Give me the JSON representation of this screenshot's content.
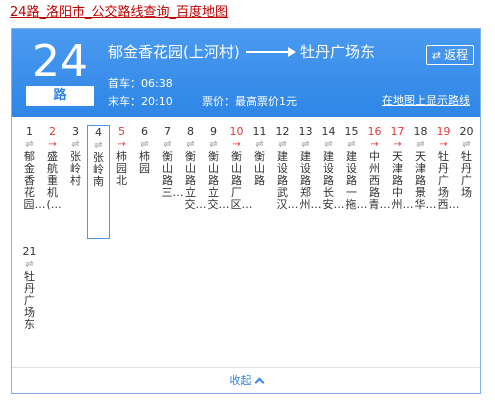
{
  "page_link": "24路_洛阳市_公交路线查询_百度地图",
  "route": {
    "number": "24",
    "unit": "路",
    "from": "郁金香花园(上河村)",
    "to": "牡丹广场东",
    "return_label": "返程",
    "first_bus": "首车：06:38",
    "last_bus": "末车：20:10",
    "fare": "票价：最高票价1元",
    "map_link": "在地图上显示路线"
  },
  "stops": [
    {
      "num": "1",
      "name": "郁金香花园…",
      "highlight": false,
      "selected": false
    },
    {
      "num": "2",
      "name": "盛航重机(…",
      "highlight": true,
      "selected": false
    },
    {
      "num": "3",
      "name": "张岭村",
      "highlight": false,
      "selected": false
    },
    {
      "num": "4",
      "name": "张岭南",
      "highlight": false,
      "selected": true
    },
    {
      "num": "5",
      "name": "柿园北",
      "highlight": true,
      "selected": false
    },
    {
      "num": "6",
      "name": "柿园",
      "highlight": false,
      "selected": false
    },
    {
      "num": "7",
      "name": "衡山路三…",
      "highlight": false,
      "selected": false
    },
    {
      "num": "8",
      "name": "衡山路立交…",
      "highlight": false,
      "selected": false
    },
    {
      "num": "9",
      "name": "衡山路立交…",
      "highlight": false,
      "selected": false
    },
    {
      "num": "10",
      "name": "衡山路厂区…",
      "highlight": true,
      "selected": false
    },
    {
      "num": "11",
      "name": "衡山路",
      "highlight": false,
      "selected": false
    },
    {
      "num": "12",
      "name": "建设路武汉…",
      "highlight": false,
      "selected": false
    },
    {
      "num": "13",
      "name": "建设路郑州…",
      "highlight": false,
      "selected": false
    },
    {
      "num": "14",
      "name": "建设路长安…",
      "highlight": false,
      "selected": false
    },
    {
      "num": "15",
      "name": "建设路一拖…",
      "highlight": false,
      "selected": false
    },
    {
      "num": "16",
      "name": "中州西路青…",
      "highlight": true,
      "selected": false
    },
    {
      "num": "17",
      "name": "天津路中州…",
      "highlight": true,
      "selected": false
    },
    {
      "num": "18",
      "name": "天津路景华…",
      "highlight": false,
      "selected": false
    },
    {
      "num": "19",
      "name": "牡丹广场西…",
      "highlight": true,
      "selected": false
    },
    {
      "num": "20",
      "name": "牡丹广场",
      "highlight": false,
      "selected": false
    },
    {
      "num": "21",
      "name": "牡丹广场东",
      "highlight": false,
      "selected": false
    }
  ],
  "collapse_label": "收起",
  "colors": {
    "header_blue": "#2f86e6",
    "highlight_red": "#e4393c"
  }
}
